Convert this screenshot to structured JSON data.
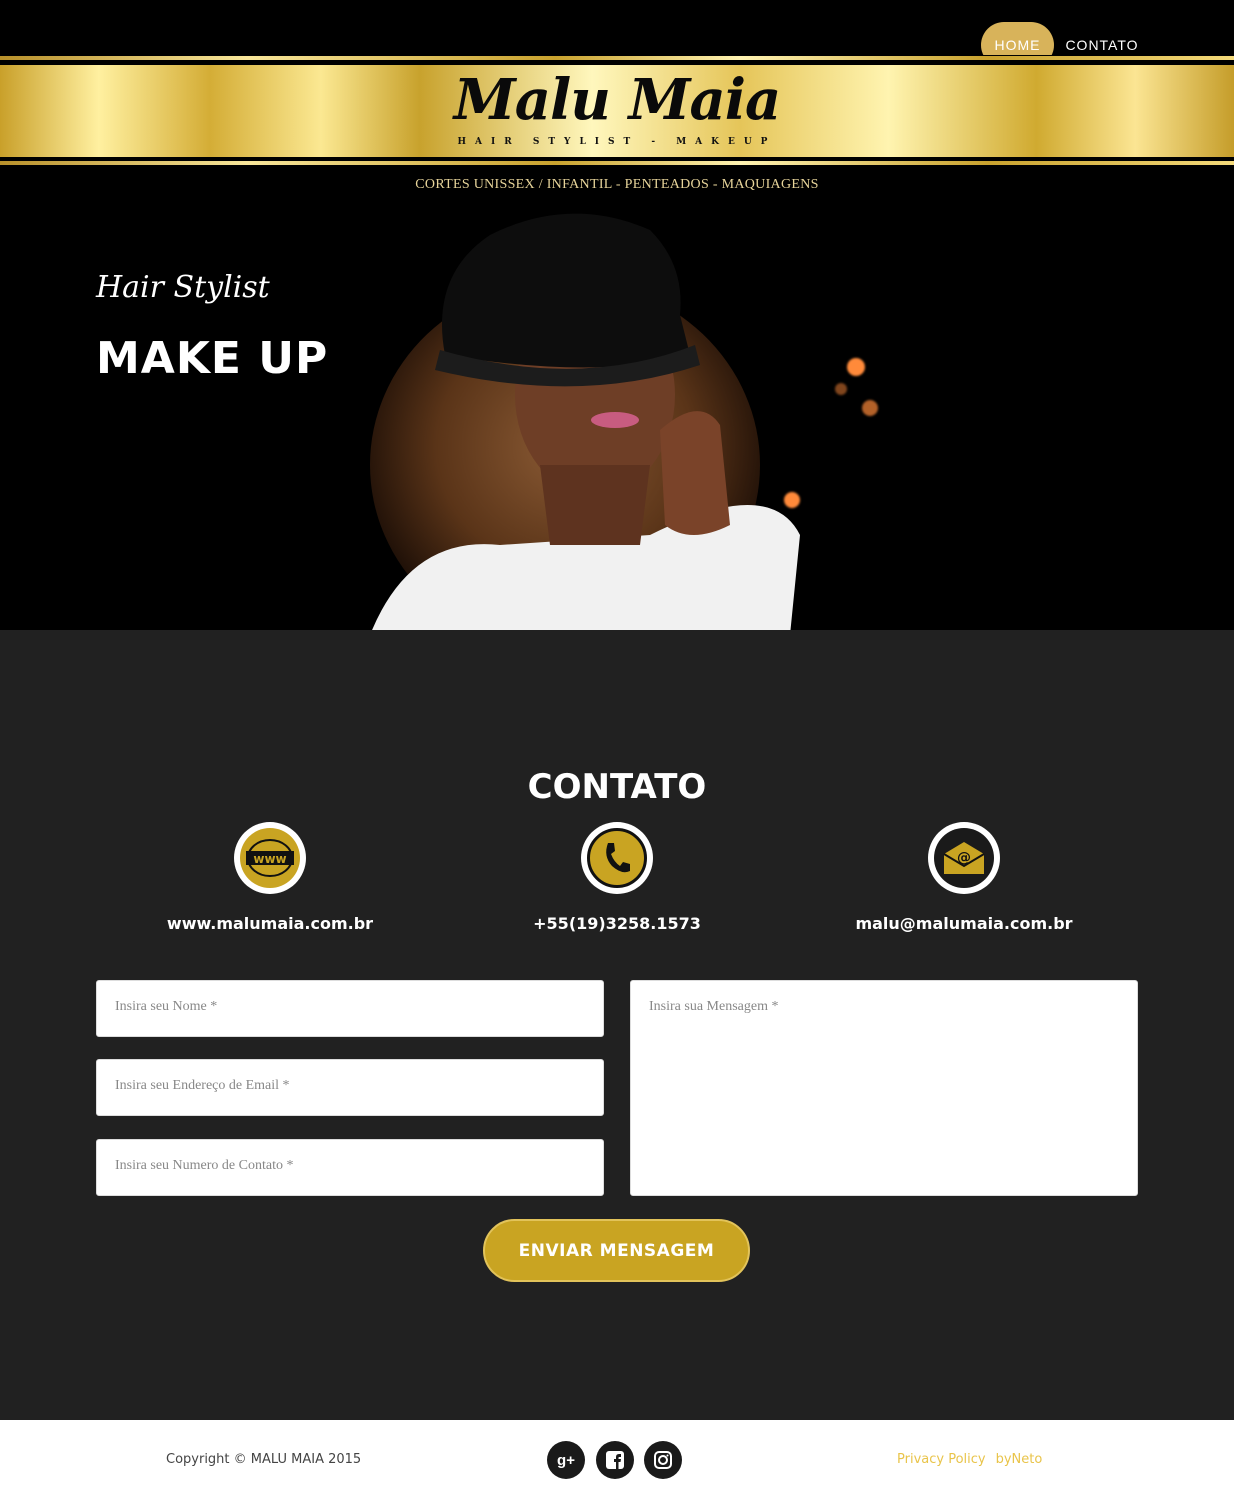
{
  "nav": {
    "home": "HOME",
    "contato": "CONTATO"
  },
  "logo": {
    "name": "Malu Maia",
    "tagline": "HAIR STYLIST - MAKEUP"
  },
  "services": "CORTES UNISSEX / INFANTIL  -  PENTEADOS  -  MAQUIAGENS",
  "hero": {
    "subtitle": "Hair Stylist",
    "title": "MAKE UP"
  },
  "contact": {
    "title": "CONTATO",
    "website": "www.malumaia.com.br",
    "phone": "+55(19)3258.1573",
    "email": "malu@malumaia.com.br",
    "icons": {
      "website": "www-globe-icon",
      "phone": "phone-icon",
      "email": "email-envelope-icon"
    }
  },
  "form": {
    "name_placeholder": "Insira seu Nome *",
    "email_placeholder": "Insira seu Endereço de Email *",
    "phone_placeholder": "Insira seu Numero de Contato *",
    "message_placeholder": "Insira sua Mensagem *",
    "send_label": "ENVIAR MENSAGEM"
  },
  "footer": {
    "copyright": "Copyright © MALU MAIA 2015",
    "social": [
      "google-plus-icon",
      "facebook-icon",
      "instagram-icon"
    ],
    "privacy": "Privacy Policy",
    "by": "byNeto"
  },
  "colors": {
    "gold": "#c9a422",
    "nav_home_bg": "#d8b35a",
    "section_bg": "#212121"
  }
}
